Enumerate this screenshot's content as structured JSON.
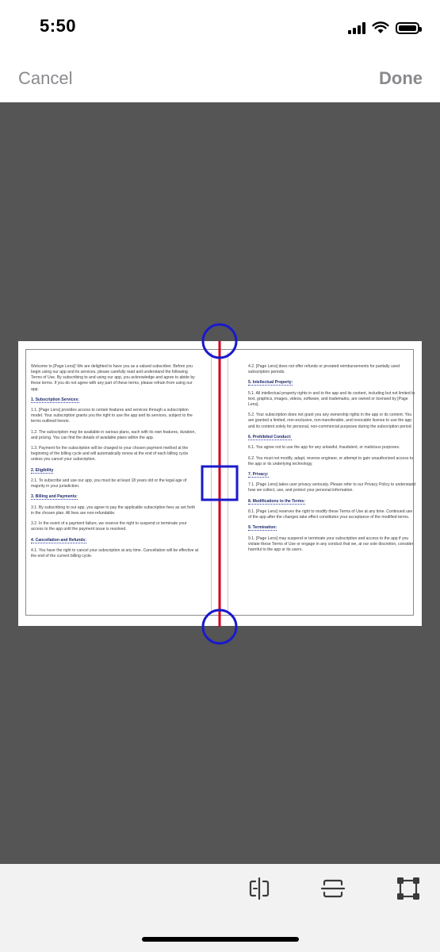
{
  "status_bar": {
    "time": "5:50"
  },
  "nav": {
    "cancel_label": "Cancel",
    "done_label": "Done"
  },
  "colors": {
    "canvas_background": "#555555",
    "split_line": "#d0021b",
    "handle": "#1a1acc",
    "nav_text": "#8a8a8e"
  },
  "document": {
    "left_column": [
      {
        "type": "text",
        "text": "Welcome to [Page Lens]! We are delighted to have you as a valued subscriber. Before you begin using our app and its services, please carefully read and understand the following Terms of Use. By subscribing to and using our app, you acknowledge and agree to abide by these terms. If you do not agree with any part of these terms, please refrain from using our app."
      },
      {
        "type": "heading",
        "text": "1.  Subscription Services:"
      },
      {
        "type": "text",
        "text": "1.1. [Page Lens] provides access to certain features and services through a subscription model. Your subscription grants you the right to use the app and its services, subject to the terms outlined herein."
      },
      {
        "type": "text",
        "text": "1.2. The subscription may be available in various plans, each with its own features, duration, and pricing. You can find the details of available plans within the app."
      },
      {
        "type": "text",
        "text": "1.3. Payment for the subscription will be charged to your chosen payment method at the beginning of the billing cycle and will automatically renew at the end of each billing cycle unless you cancel your subscription."
      },
      {
        "type": "heading",
        "text": "2.  Eligibility"
      },
      {
        "type": "text",
        "text": "2.1. To subscribe and use our app, you must be at least 18 years old or the legal age of majority in your jurisdiction."
      },
      {
        "type": "heading",
        "text": "3.  Billing and Payments:"
      },
      {
        "type": "text",
        "text": "3.1. By subscribing to our app, you agree to pay the applicable subscription fees as set forth in the chosen plan. All fees are non-refundable."
      },
      {
        "type": "text",
        "text": "3.2. In the event of a payment failure, we reserve the right to suspend or terminate your access to the app until the payment issue is resolved."
      },
      {
        "type": "heading",
        "text": "4.  Cancellation and Refunds:"
      },
      {
        "type": "text",
        "text": "4.1. You have the right to cancel your subscription at any time. Cancellation will be effective at the end of the current billing cycle."
      }
    ],
    "right_column": [
      {
        "type": "text",
        "text": "4.2. [Page Lens] does not offer refunds or prorated reimbursements for partially used subscription periods."
      },
      {
        "type": "heading",
        "text": "5. Intellectual Property:"
      },
      {
        "type": "text",
        "text": "5.1. All intellectual property rights in and to the app and its content, including but not limited to text, graphics, images, videos, software, and trademarks, are owned or licensed by [Page Lens]."
      },
      {
        "type": "text",
        "text": "5.2. Your subscription does not grant you any ownership rights in the app or its content. You are granted a limited, non-exclusive, non-transferable, and revocable license to use the app and its content solely for personal, non-commercial purposes during the subscription period."
      },
      {
        "type": "heading",
        "text": "6. Prohibited Conduct:"
      },
      {
        "type": "text",
        "text": "6.1. You agree not to use the app for any unlawful, fraudulent, or malicious purposes."
      },
      {
        "type": "text",
        "text": "6.2. You must not modify, adapt, reverse engineer, or attempt to gain unauthorized access to the app or its underlying technology."
      },
      {
        "type": "heading",
        "text": "7. Privacy:"
      },
      {
        "type": "text",
        "text": "7.1. [Page Lens] takes user privacy seriously. Please refer to our Privacy Policy to understand how we collect, use, and protect your personal information."
      },
      {
        "type": "heading",
        "text": "8. Modifications to the Terms:"
      },
      {
        "type": "text",
        "text": "8.1. [Page Lens] reserves the right to modify these Terms of Use at any time. Continued use of the app after the changes take effect constitutes your acceptance of the modified terms."
      },
      {
        "type": "heading",
        "text": "9. Termination:"
      },
      {
        "type": "text",
        "text": "9.1. [Page Lens] may suspend or terminate your subscription and access to the app if you violate these Terms of Use or engage in any conduct that we, at our sole discretion, consider harmful to the app or its users."
      }
    ]
  },
  "toolbar": {
    "icons": [
      "split-page-icon",
      "horizontal-split-icon",
      "crop-corners-icon"
    ]
  }
}
